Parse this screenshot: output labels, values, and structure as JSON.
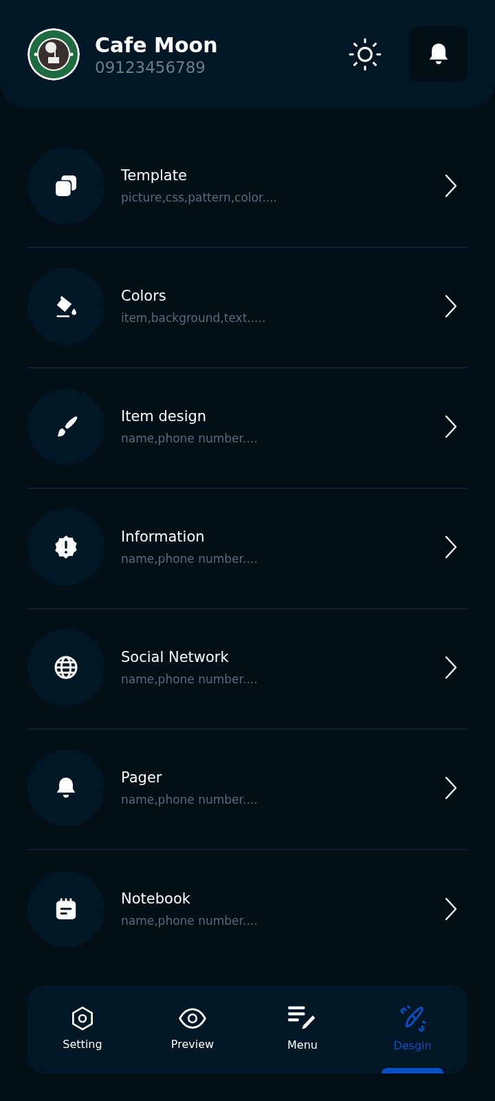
{
  "header": {
    "title": "Cafe Moon",
    "phone": "09123456789"
  },
  "items": [
    {
      "title": "Template",
      "subtitle": "picture,css,pattern,color...."
    },
    {
      "title": "Colors",
      "subtitle": "item,background,text....."
    },
    {
      "title": "Item design",
      "subtitle": "name,phone number...."
    },
    {
      "title": "Information",
      "subtitle": "name,phone number...."
    },
    {
      "title": "Social Network",
      "subtitle": "name,phone number...."
    },
    {
      "title": "Pager",
      "subtitle": "name,phone number...."
    },
    {
      "title": "Notebook",
      "subtitle": "name,phone number...."
    }
  ],
  "nav": [
    {
      "label": "Setting",
      "selected": false
    },
    {
      "label": "Preview",
      "selected": false
    },
    {
      "label": "Menu",
      "selected": false
    },
    {
      "label": "Desgin",
      "selected": true
    }
  ]
}
